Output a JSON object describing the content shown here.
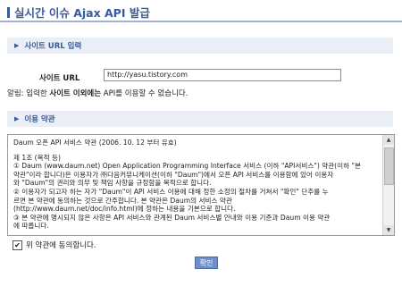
{
  "page": {
    "title": "실시간 이슈 Ajax API 발급"
  },
  "site_section": {
    "heading": "사이트 URL 입력",
    "url_label": "사이트 URL",
    "url_value": "http://yasu.tistory.com"
  },
  "notice": {
    "prefix": "알림: 입력한 ",
    "emphasis": "사이트 이외에는",
    "suffix": " API를 이용할 수 없습니다."
  },
  "terms_section": {
    "heading": "이용 약관",
    "lines": [
      "Daum 오픈 API 서비스 약관 (2006. 10. 12 부터 유효)",
      "",
      "제 1조 (목적 등)",
      "① Daum (www.daum.net) Open Application Programming Interface 서비스 (이하 \"API서비스\") 약관(이하 \"본",
      "약관\"이라 합니다)은 이용자가 ㈜다음커뮤니케이션(이하 \"Daum\")에서 오픈 API 서비스를 이용함에 있어 이용자",
      "와 \"Daum\"의 권리와 의무 및 책임 사항을 규정함을 목적으로 합니다.",
      "② 이용자가 되고자 하는 자가 \"Daum\"이 API 서비스 이용에 대해 정한 소정의 절차를 거쳐서 \"확인\" 단추를 누",
      "르면 본 약관에 동의하는 것으로 간주합니다. 본 약관은 Daum의 서비스 약관",
      "(http://www.daum.net/doc/info.html)에 정하는 내용을 기본으로 합니다.",
      "③ 본 약관에 명시되지 않은 사항은 API 서비스와 관계된 Daum 서비스별 안내와 이용 기준과 Daum 이용 약관",
      "에 따릅니다."
    ]
  },
  "agree": {
    "checked": true,
    "label": "위 약관에 동의합니다."
  },
  "confirm_button": {
    "label": "확인"
  },
  "colors": {
    "accent": "#3a5a9a",
    "section_bg": "#e9eef7",
    "button_bg": "#6f8fc8"
  }
}
